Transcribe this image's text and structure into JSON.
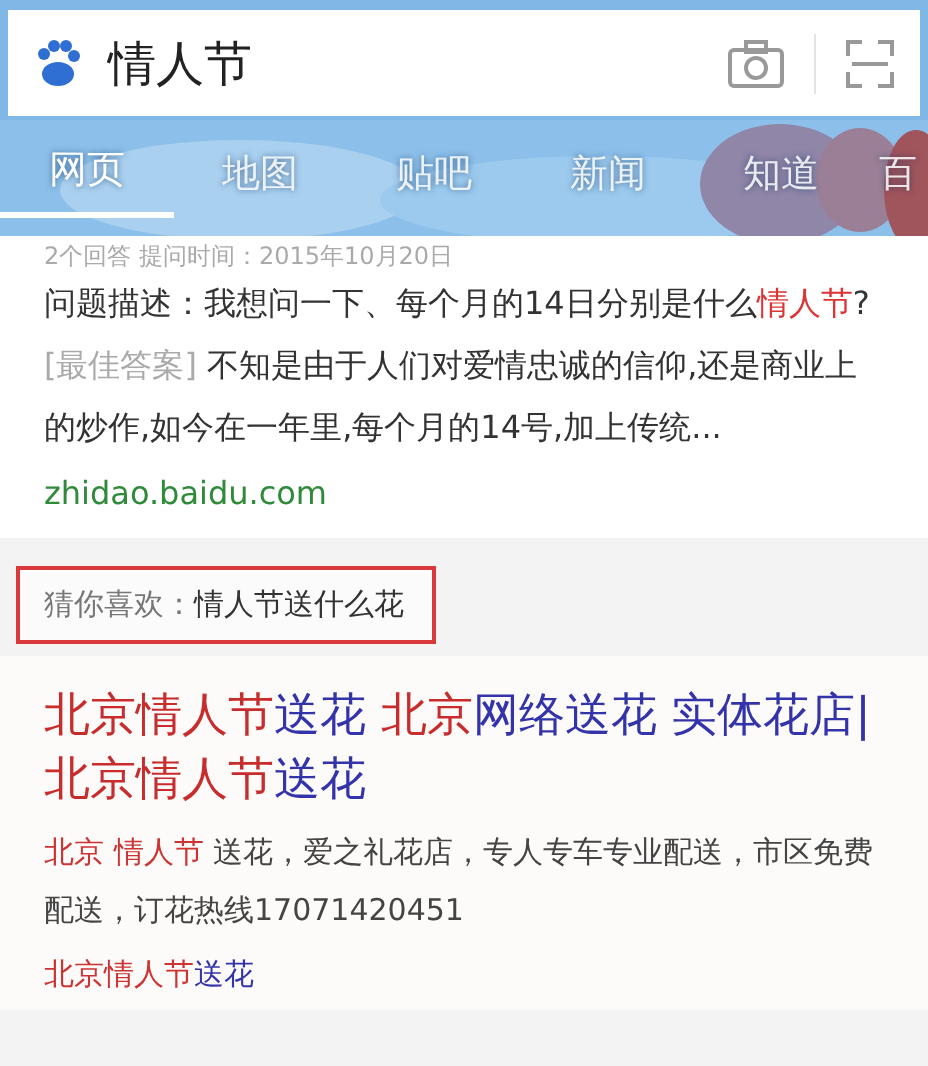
{
  "search": {
    "query": "情人节"
  },
  "tabs": [
    {
      "label": "网页",
      "selected": true
    },
    {
      "label": "地图",
      "selected": false
    },
    {
      "label": "贴吧",
      "selected": false
    },
    {
      "label": "新闻",
      "selected": false
    },
    {
      "label": "知道",
      "selected": false
    },
    {
      "label": "百",
      "selected": false
    }
  ],
  "zhidao_result": {
    "meta": "2个回答 提问时间：2015年10月20日",
    "question": [
      {
        "text": "问题描述：我想问一下、每个月的14日分别是什么",
        "highlight": false
      },
      {
        "text": "情人节",
        "highlight": true
      },
      {
        "text": "?",
        "highlight": false
      }
    ],
    "answer_label": "[最佳答案]",
    "answer": "不知是由于人们对爱情忠诚的信仰,还是商业上的炒作,如今在一年里,每个月的14号,加上传统...",
    "url": "zhidao.baidu.com"
  },
  "suggestion": {
    "label": "猜你喜欢：",
    "query": "情人节送什么花"
  },
  "ad_result": {
    "title": [
      {
        "text": "北京情人节",
        "highlight": true
      },
      {
        "text": "送花 ",
        "highlight": false
      },
      {
        "text": "北京",
        "highlight": true
      },
      {
        "text": "网络送花 实体花店|",
        "highlight": false
      },
      {
        "text": "北京情人节",
        "highlight": true
      },
      {
        "text": "送花",
        "highlight": false
      }
    ],
    "description": [
      {
        "text": "北京 情人节",
        "highlight": true
      },
      {
        "text": " 送花，爱之礼花店，专人专车专业配送，市区免费配送，订花热线17071420451",
        "highlight": false
      }
    ],
    "link": [
      {
        "text": "北京情人节",
        "highlight": true
      },
      {
        "text": "送花",
        "highlight": false
      }
    ]
  }
}
